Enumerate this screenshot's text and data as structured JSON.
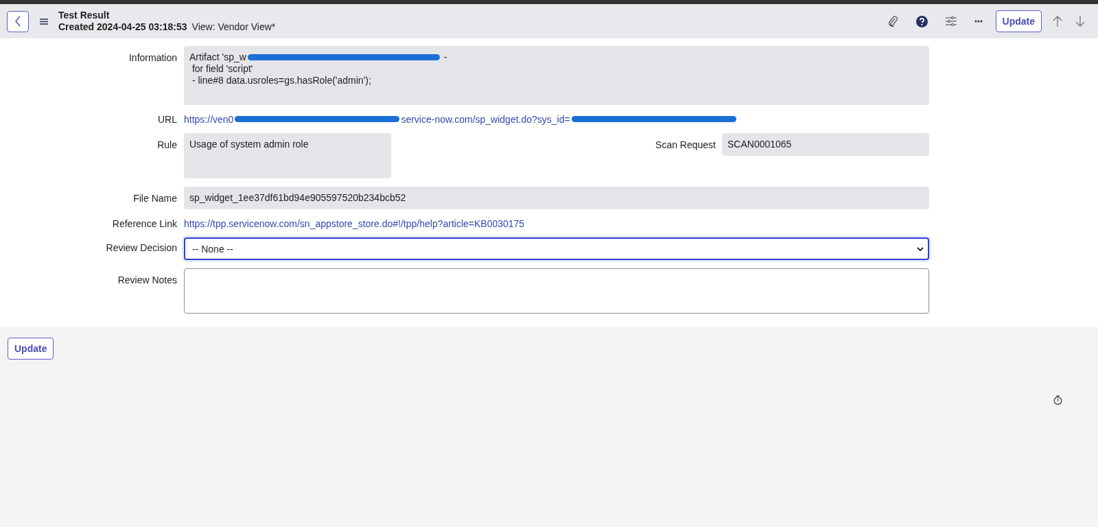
{
  "header": {
    "title": "Test Result",
    "created": "Created 2024-04-25 03:18:53",
    "view": "View: Vendor View*",
    "update_button": "Update"
  },
  "information": {
    "label": "Information",
    "lines": [
      [
        {
          "kind": "text",
          "text": "Artifact 'sp_w"
        },
        {
          "kind": "redacted"
        },
        {
          "kind": "text",
          "text": " -"
        }
      ],
      [
        {
          "kind": "text",
          "text": " for field 'script'"
        }
      ],
      [
        {
          "kind": "text",
          "text": " - line#8 data.usroles=gs.hasRole('admin');"
        }
      ]
    ]
  },
  "url": {
    "label": "URL",
    "parts": [
      {
        "kind": "text",
        "text": "https://ven0"
      },
      {
        "kind": "redacted"
      },
      {
        "kind": "text",
        "text": "service-now.com/sp_widget.do?sys_id="
      },
      {
        "kind": "redacted"
      }
    ]
  },
  "rule": {
    "label": "Rule",
    "value": "Usage of system admin role"
  },
  "scan_request": {
    "label": "Scan Request",
    "value": "SCAN0001065"
  },
  "file_name": {
    "label": "File Name",
    "value": "sp_widget_1ee37df61bd94e905597520b234bcb52"
  },
  "reference_link": {
    "label": "Reference Link",
    "value": "https://tpp.servicenow.com/sn_appstore_store.do#!/tpp/help?article=KB0030175"
  },
  "review_decision": {
    "label": "Review Decision",
    "value": "-- None --",
    "focused": true
  },
  "review_notes": {
    "label": "Review Notes"
  },
  "footer_button": "Update"
}
